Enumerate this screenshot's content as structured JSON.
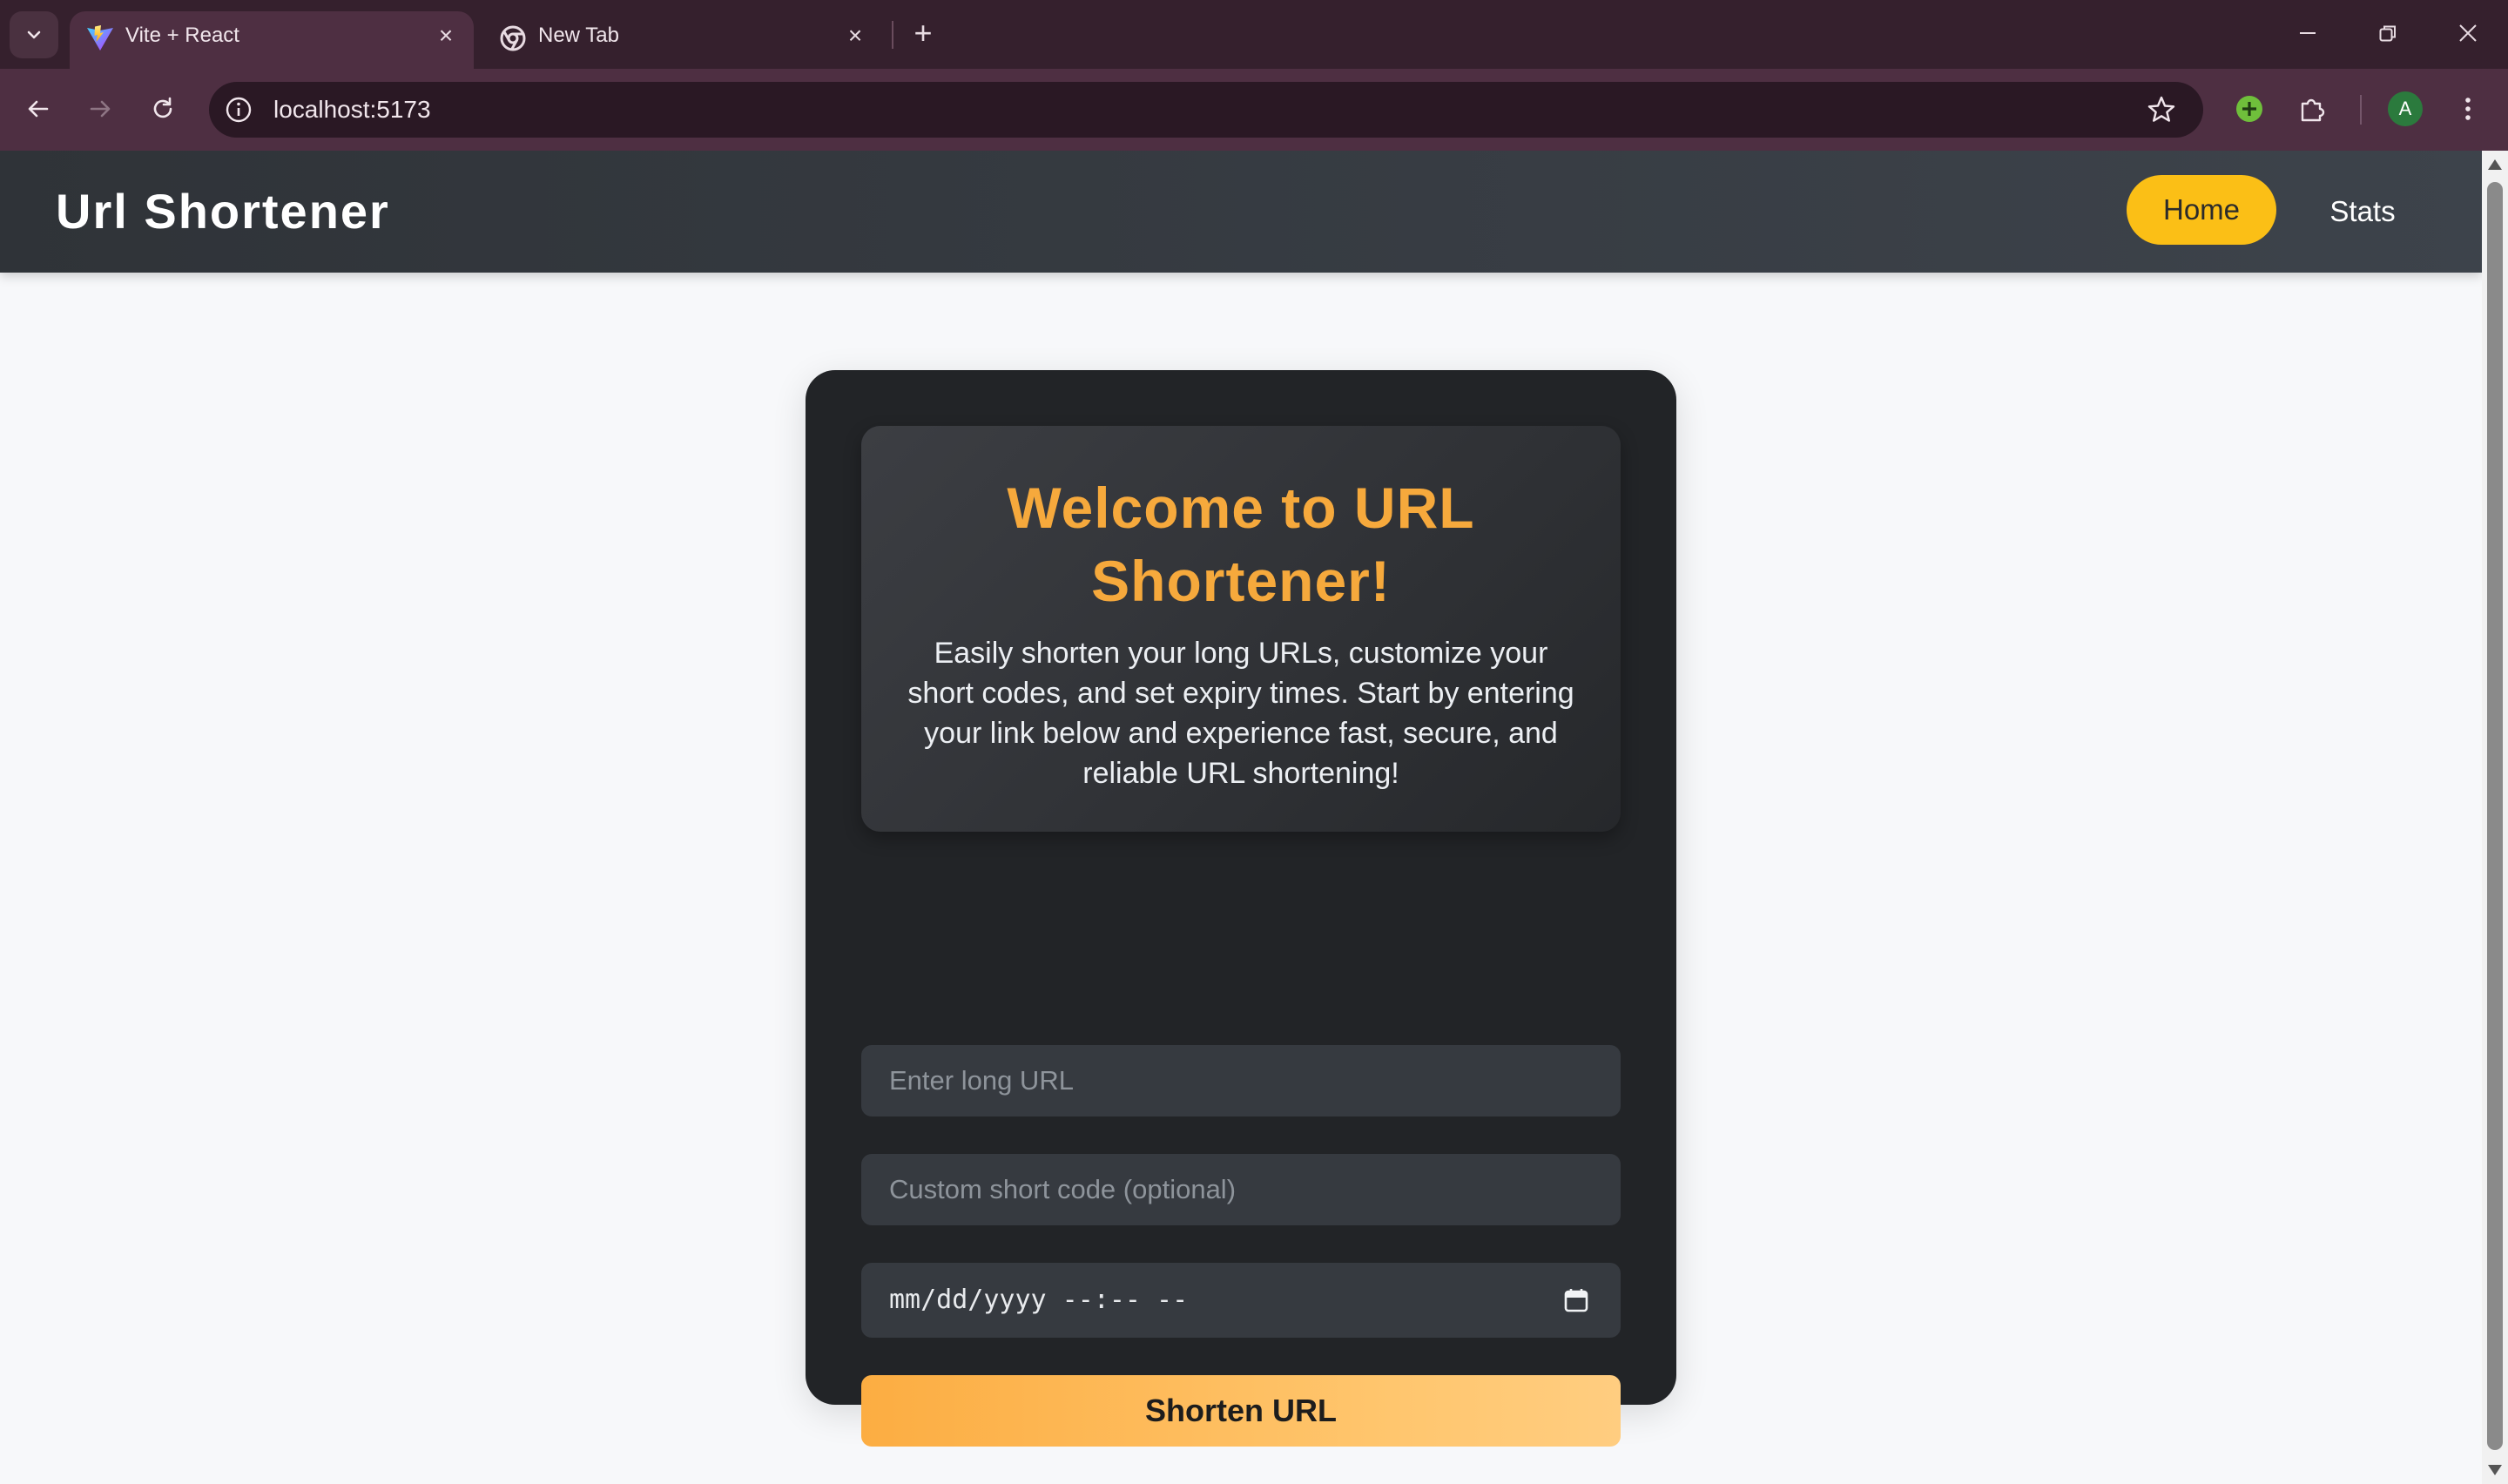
{
  "browser": {
    "tabs": [
      {
        "title": "Vite + React",
        "icon": "vite-icon",
        "active": true
      },
      {
        "title": "New Tab",
        "icon": "chrome-icon",
        "active": false
      }
    ],
    "address": "localhost:5173",
    "profile_initial": "A",
    "colors": {
      "frame": "#35202d",
      "toolbar": "#4e2f42",
      "omnibox": "#2a1824"
    }
  },
  "app": {
    "brand": "Url Shortener",
    "nav": [
      {
        "label": "Home",
        "active": true
      },
      {
        "label": "Stats",
        "active": false
      }
    ]
  },
  "hero": {
    "title": "Welcome to URL Shortener!",
    "description": "Easily shorten your long URLs, customize your short codes, and set expiry times. Start by entering your link below and experience fast, secure, and reliable URL shortening!"
  },
  "form": {
    "long_url_placeholder": "Enter long URL",
    "short_code_placeholder": "Custom short code (optional)",
    "expiry_placeholder": "mm/dd/yyyy --:-- --",
    "submit_label": "Shorten URL"
  },
  "colors": {
    "accent": "#fbbf16",
    "title": "#f6a93c",
    "card": "#222427",
    "navbar": "#2f3338",
    "button_gradient": [
      "#fcad42",
      "#ffcd80"
    ]
  }
}
